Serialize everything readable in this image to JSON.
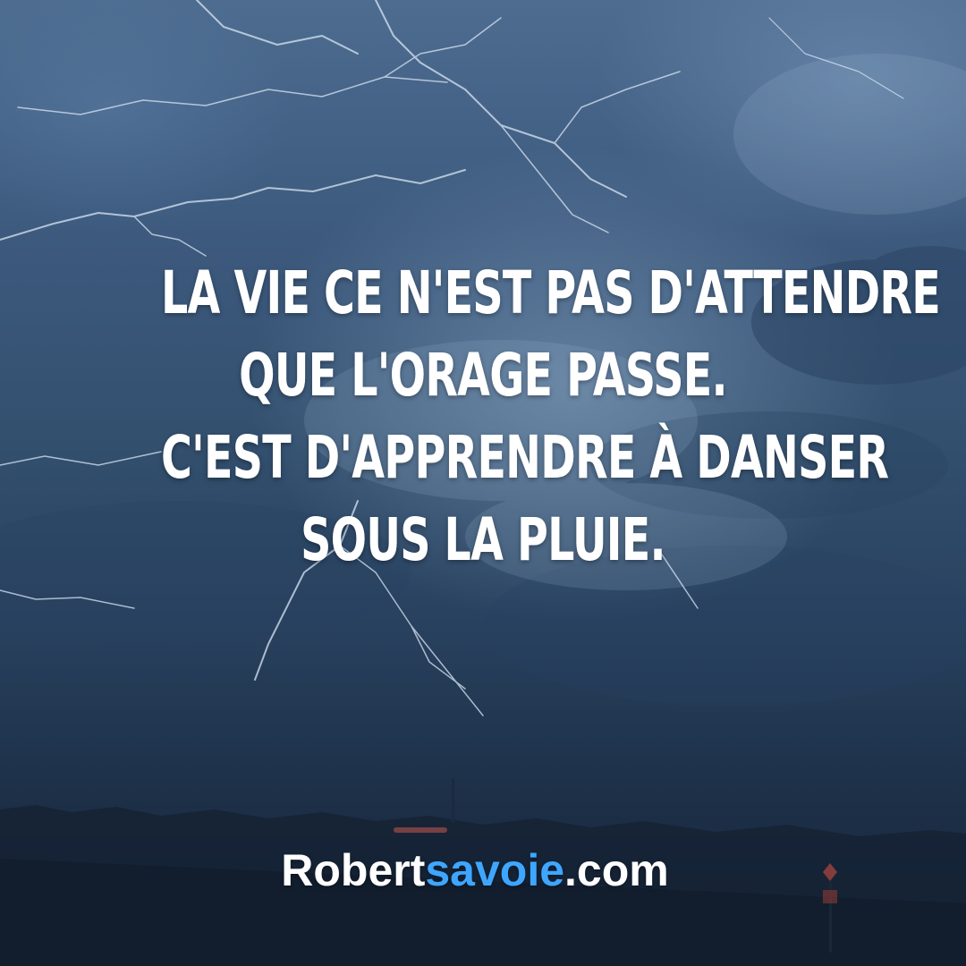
{
  "quote": {
    "line1": "LA VIE CE N'EST PAS D'ATTENDRE",
    "line2": "QUE L'ORAGE PASSE.",
    "line3": "C'EST D'APPRENDRE À DANSER",
    "line4": "SOUS LA PLUIE."
  },
  "brand": {
    "part1": "Robert",
    "part2": "savoie",
    "part3": ".com",
    "accent_color": "#3ea6ff"
  }
}
